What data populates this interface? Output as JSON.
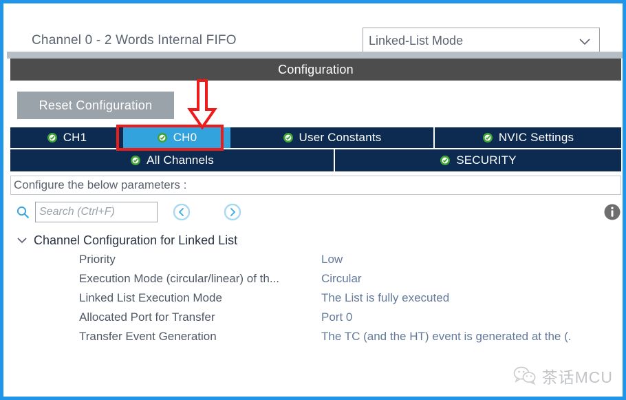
{
  "header": {
    "channel_title": "Channel 0  - 2 Words Internal FIFO",
    "mode_select": {
      "value": "Linked-List Mode",
      "icon": "chevron-down-icon"
    }
  },
  "config_bar": {
    "title": "Configuration"
  },
  "toolbar": {
    "reset_label": "Reset Configuration"
  },
  "tabs": {
    "row1": [
      {
        "label": "CH1",
        "selected": false,
        "icon": "green-check-icon"
      },
      {
        "label": "CH0",
        "selected": true,
        "icon": "green-check-icon"
      },
      {
        "label": "User Constants",
        "selected": false,
        "icon": "green-check-icon"
      },
      {
        "label": "NVIC Settings",
        "selected": false,
        "icon": "green-check-icon"
      }
    ],
    "row2": [
      {
        "label": "All Channels",
        "selected": false,
        "icon": "green-check-icon"
      },
      {
        "label": "SECURITY",
        "selected": false,
        "icon": "green-check-icon"
      }
    ]
  },
  "annotation": {
    "highlight_color": "#ee1b1b",
    "arrow": "down-arrow-annotation",
    "target_tab": "CH0"
  },
  "params_panel": {
    "instruction": "Configure the below parameters :",
    "search": {
      "placeholder": "Search (Ctrl+F)",
      "value": "",
      "icon": "search-icon"
    },
    "prev_icon": "chevron-left-circle-icon",
    "next_icon": "chevron-right-circle-icon",
    "info_icon": "info-icon"
  },
  "tree": {
    "group_label": "Channel Configuration for Linked List",
    "expanded": true,
    "expander_icon": "chevron-down-icon",
    "rows": [
      {
        "name": "Priority",
        "value": "Low"
      },
      {
        "name": "Execution Mode (circular/linear) of th...",
        "value": "Circular"
      },
      {
        "name": "Linked List Execution Mode",
        "value": "The List is fully executed"
      },
      {
        "name": "Allocated Port for Transfer",
        "value": "Port 0"
      },
      {
        "name": "Transfer Event Generation",
        "value": "The TC (and the HT) event is generated at the (."
      }
    ]
  },
  "watermark": {
    "text": "茶话MCU",
    "icon": "wechat-icon"
  },
  "colors": {
    "frame_border": "#2196e8",
    "tabbar_bg": "#0d2b50",
    "selected_tab_bg": "#33a3dd",
    "config_bar_bg": "#4d4d4d",
    "gray_strip": "#b6bec6",
    "reset_btn_bg": "#9aa2aa",
    "accent_red": "#ee1b1b"
  }
}
